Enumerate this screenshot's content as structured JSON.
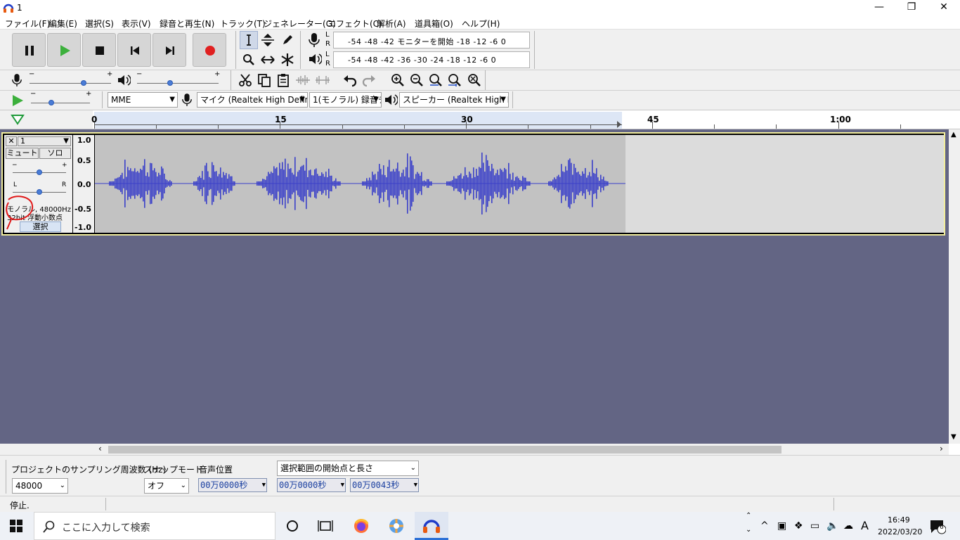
{
  "window": {
    "title": "1",
    "minimize": "—",
    "restore": "❐",
    "close": "✕"
  },
  "menus": [
    "ファイル(F)",
    "編集(E)",
    "選択(S)",
    "表示(V)",
    "録音と再生(N)",
    "トラック(T)",
    "ジェネレーター(G)",
    "エフェクト(C)",
    "解析(A)",
    "道具箱(O)",
    "ヘルプ(H)"
  ],
  "meters": {
    "record_scale": "-54  -48  -42  モニターを開始  -18  -12  -6  0",
    "play_scale": "-54  -48  -42  -36  -30  -24  -18  -12  -6  0",
    "L": "L",
    "R": "R"
  },
  "sliders": {
    "rec_level": 0.5,
    "play_level": 0.5,
    "play_speed": 0.35,
    "plus": "+",
    "minus": "−"
  },
  "devices": {
    "host": "MME",
    "input": "マイク (Realtek High Defini",
    "channels": "1(モノラル) 録音チ",
    "output": "スピーカー (Realtek High D"
  },
  "ruler": {
    "labels": [
      "0",
      "15",
      "30",
      "45",
      "1:00"
    ]
  },
  "track": {
    "name": "1",
    "close": "✕",
    "mute": "ミュート",
    "solo": "ソロ",
    "gain_minus": "−",
    "gain_plus": "+",
    "pan_left": "L",
    "pan_right": "R",
    "info_line1": "モノラル, 48000Hz",
    "info_line2": "32bit 浮動小数点",
    "select": "選択",
    "scale": [
      "1.0",
      "0.5",
      "0.0",
      "-0.5",
      "-1.0"
    ]
  },
  "selection": {
    "rate_label": "プロジェクトのサンプリング周波数 (Hz)",
    "rate_value": "48000",
    "snap_label": "スナップモード",
    "snap_value": "オフ",
    "pos_label": "音声位置",
    "pos_value": "00万0000秒",
    "range_mode": "選択範囲の開始点と長さ",
    "start_value": "00万0000秒",
    "length_value": "00万0043秒"
  },
  "status": {
    "text": "停止."
  },
  "taskbar": {
    "search_placeholder": "ここに入力して検索",
    "time": "16:49",
    "date": "2022/03/20",
    "ime": "A",
    "notifications": "6"
  },
  "colors": {
    "accent": "#3b40c9",
    "track_bg": "#636584",
    "record": "#e02020",
    "play": "#2ea82e"
  }
}
